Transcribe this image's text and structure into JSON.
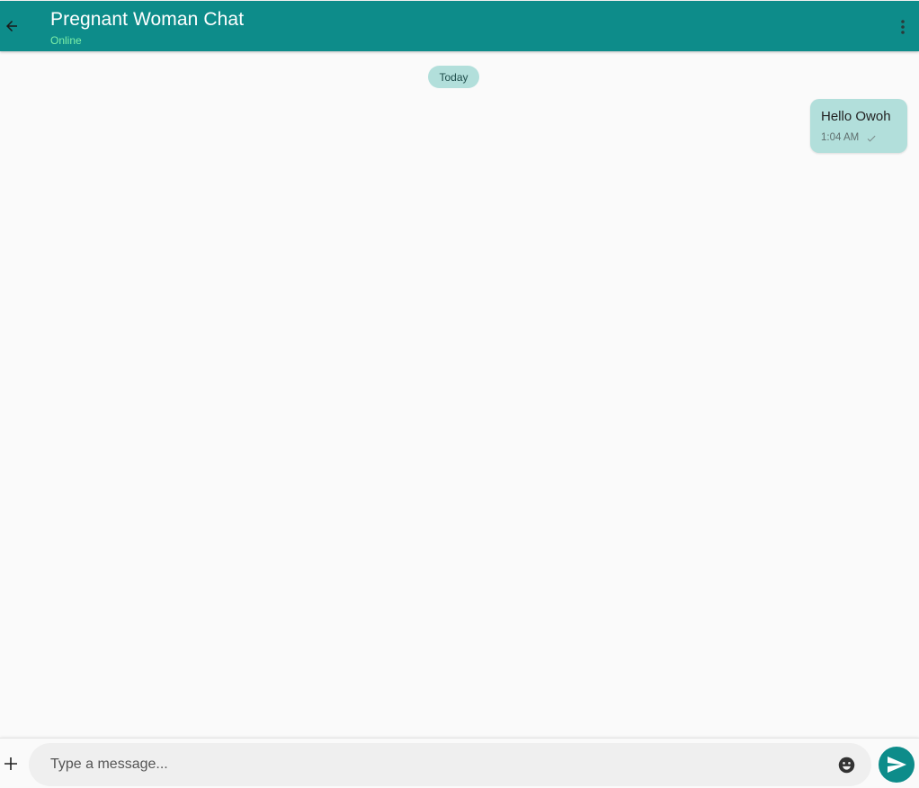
{
  "header": {
    "title": "Pregnant Woman Chat",
    "status": "Online",
    "back_icon": "arrow-left-icon",
    "menu_icon": "more-vert-icon"
  },
  "messages": {
    "date_label": "Today",
    "items": [
      {
        "text": "Hello Owoh",
        "time": "1:04 AM",
        "direction": "outgoing",
        "status_icon": "check-icon"
      }
    ]
  },
  "composer": {
    "add_icon": "plus-icon",
    "placeholder": "Type a message...",
    "value": "",
    "emoji_icon": "emoji-icon",
    "send_icon": "send-icon"
  },
  "colors": {
    "header_bg": "#0d8c8a",
    "status_text": "#7ef0a8",
    "bubble_bg": "#b2dfdb",
    "background": "#fafafa",
    "send_button": "#0d8c8a"
  }
}
